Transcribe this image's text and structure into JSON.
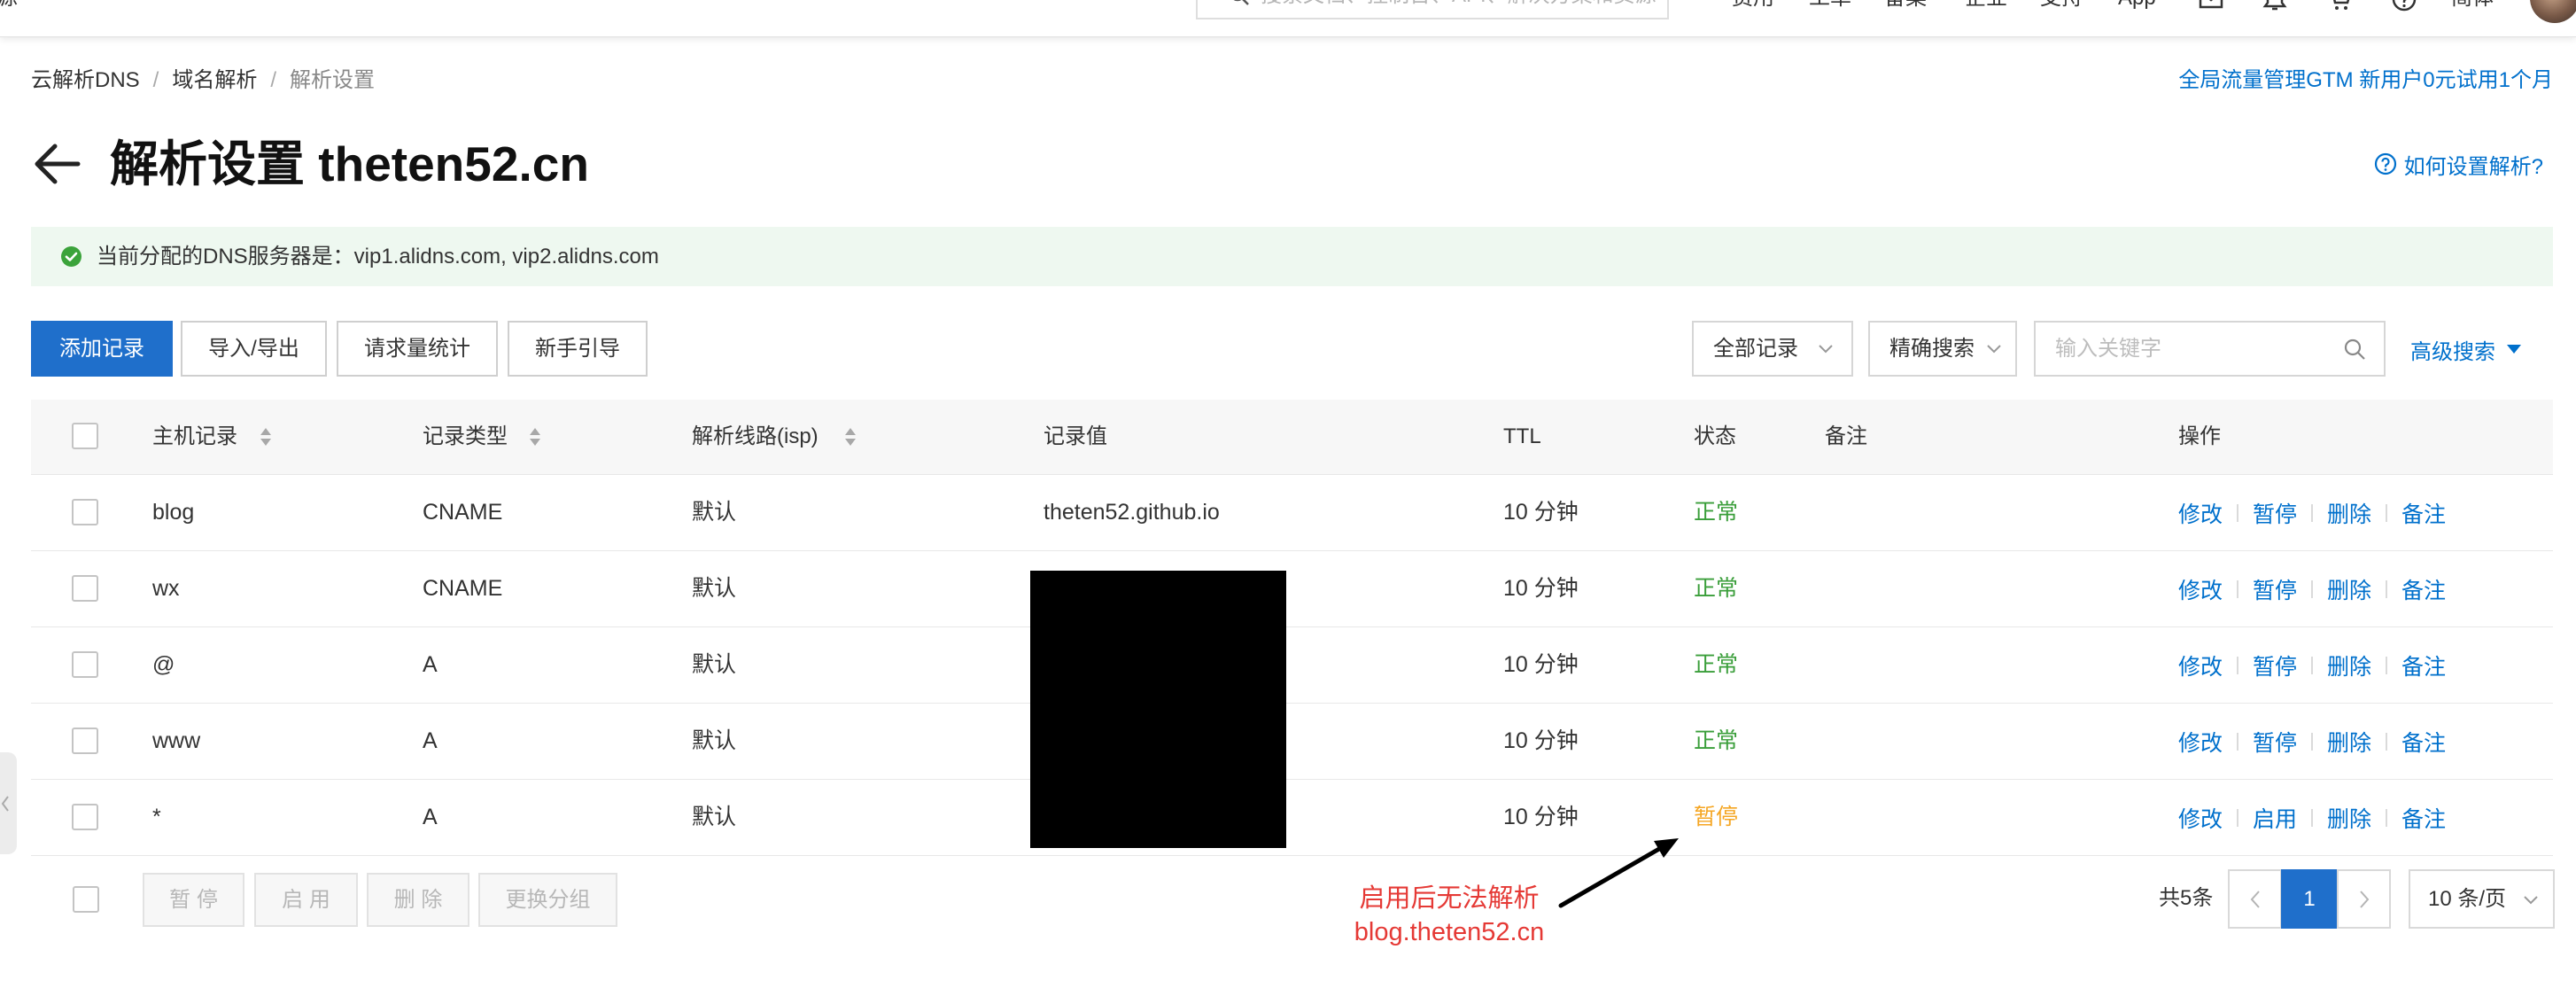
{
  "topbar": {
    "left_label": "源",
    "search_placeholder": "搜索文档、控制台、API、解决方案和资源",
    "nav": [
      "费用",
      "工单",
      "备案",
      "企业",
      "支持",
      "App"
    ],
    "icons": [
      "mail-icon",
      "bell-icon",
      "cart-icon",
      "help-icon"
    ],
    "language": "简体"
  },
  "breadcrumb": {
    "items": [
      "云解析DNS",
      "域名解析",
      "解析设置"
    ],
    "separator": "/"
  },
  "promo_link": "全局流量管理GTM 新用户0元试用1个月",
  "page": {
    "title": "解析设置 theten52.cn",
    "help_link": "如何设置解析?"
  },
  "dns_notice": "当前分配的DNS服务器是：vip1.alidns.com, vip2.alidns.com",
  "toolbar": {
    "actions": [
      "添加记录",
      "导入/导出",
      "请求量统计",
      "新手引导"
    ]
  },
  "filters": {
    "record_filter": "全部记录",
    "search_mode": "精确搜索",
    "keyword_placeholder": "输入关键字",
    "advanced_search": "高级搜索"
  },
  "table": {
    "columns": [
      "主机记录",
      "记录类型",
      "解析线路(isp)",
      "记录值",
      "TTL",
      "状态",
      "备注",
      "操作"
    ],
    "rows": [
      {
        "host": "blog",
        "type": "CNAME",
        "line": "默认",
        "value": "theten52.github.io",
        "ttl": "10 分钟",
        "status": "正常",
        "actions": [
          "修改",
          "暂停",
          "删除",
          "备注"
        ]
      },
      {
        "host": "wx",
        "type": "CNAME",
        "line": "默认",
        "redacted": true,
        "ttl": "10 分钟",
        "status": "正常",
        "actions": [
          "修改",
          "暂停",
          "删除",
          "备注"
        ]
      },
      {
        "host": "@",
        "type": "A",
        "line": "默认",
        "redacted": true,
        "ttl": "10 分钟",
        "status": "正常",
        "actions": [
          "修改",
          "暂停",
          "删除",
          "备注"
        ]
      },
      {
        "host": "www",
        "type": "A",
        "line": "默认",
        "redacted": true,
        "ttl": "10 分钟",
        "status": "正常",
        "actions": [
          "修改",
          "暂停",
          "删除",
          "备注"
        ]
      },
      {
        "host": "*",
        "type": "A",
        "line": "默认",
        "redacted": true,
        "ttl": "10 分钟",
        "status": "暂停",
        "actions": [
          "修改",
          "启用",
          "删除",
          "备注"
        ]
      }
    ]
  },
  "batch_actions": [
    "暂 停",
    "启 用",
    "删 除",
    "更换分组"
  ],
  "pagination": {
    "total": "共5条",
    "current_page": "1",
    "page_size": "10 条/页"
  },
  "annotation": {
    "lines": [
      "启用后无法解析",
      "blog.theten52.cn"
    ]
  },
  "colors": {
    "primary": "#1F6FCB",
    "link": "#0070CC",
    "status_normal": "#3A9E3A",
    "status_paused": "#F5A623",
    "annotation": "#E53935",
    "notice_bg": "#EEF8F0"
  }
}
